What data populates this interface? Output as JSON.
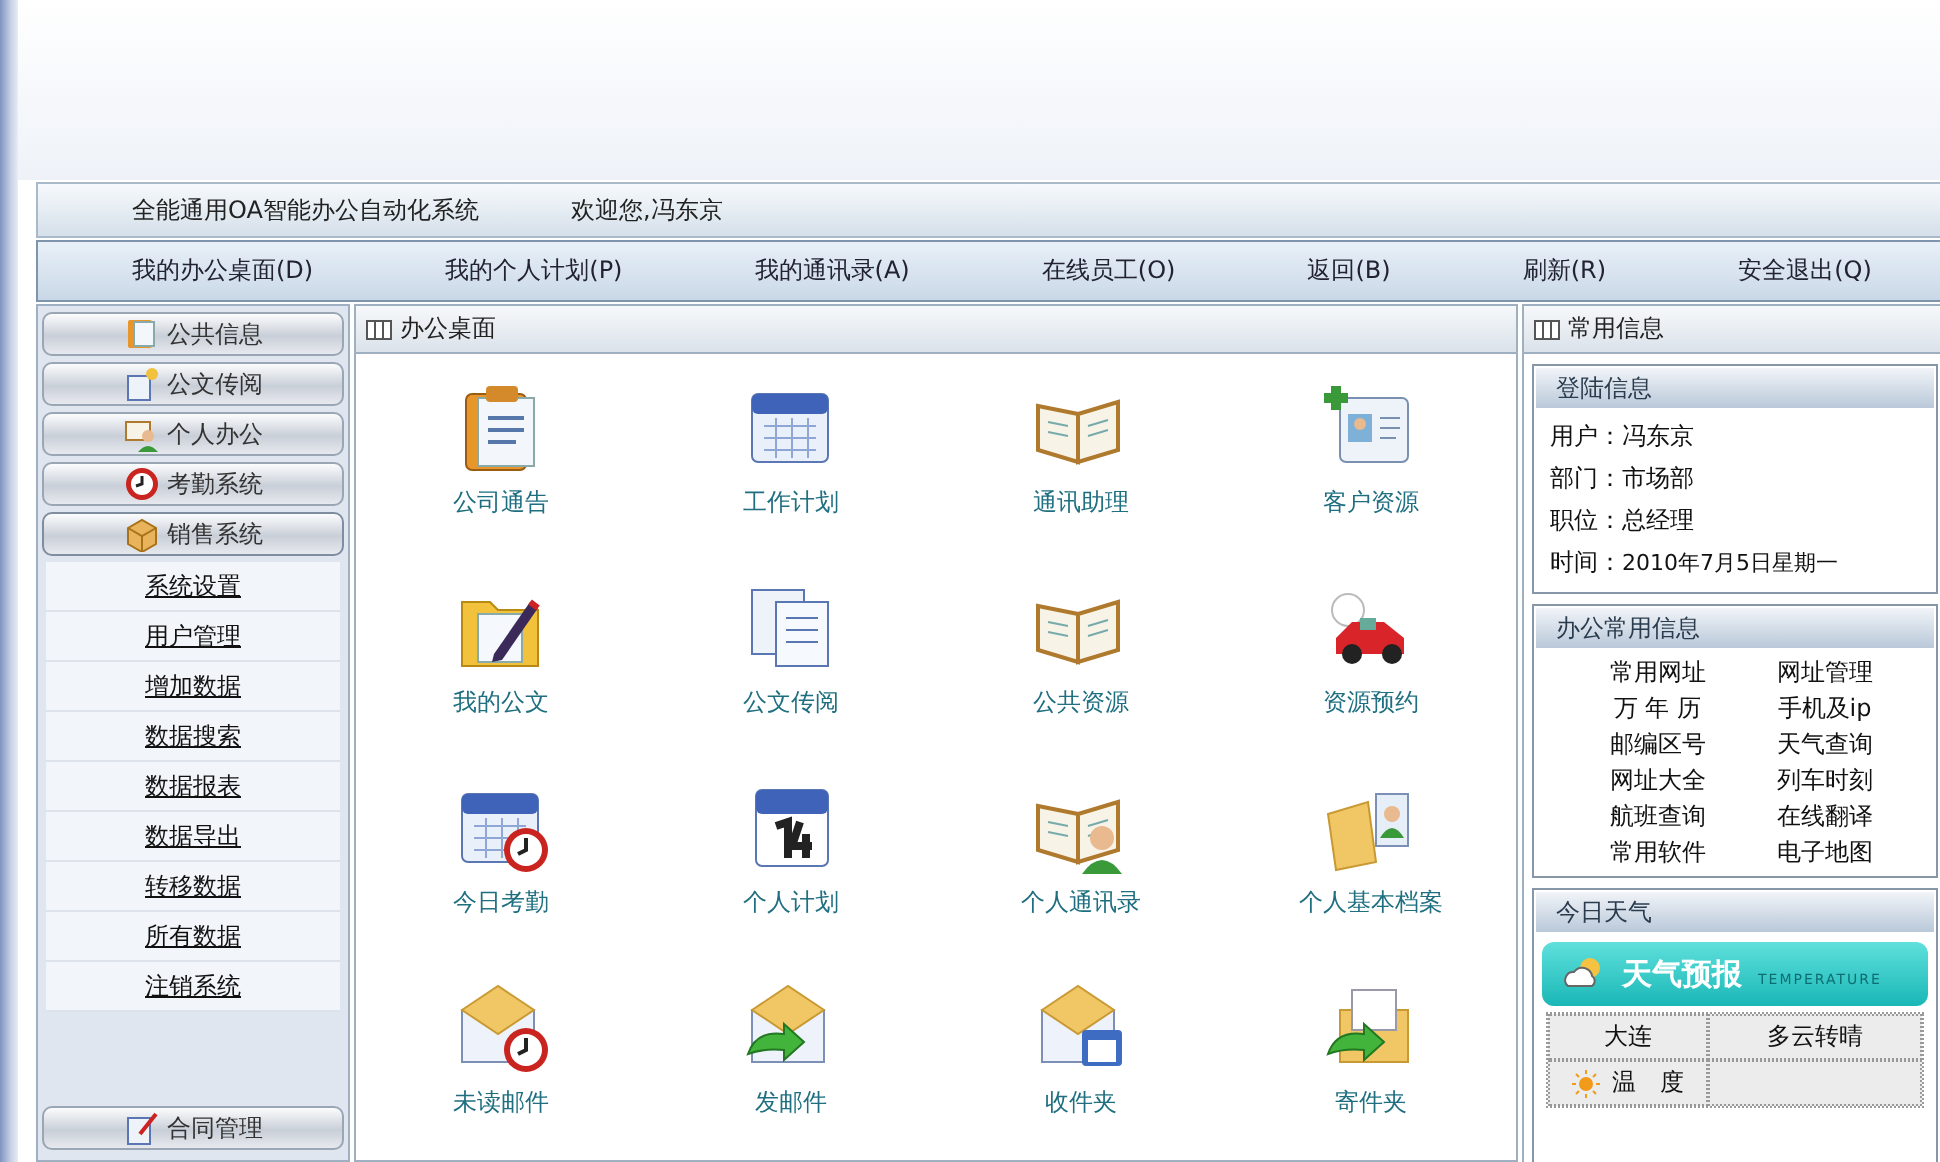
{
  "header": {
    "title": "全能通用OA智能办公自动化系统",
    "welcome": "欢迎您,冯东京"
  },
  "nav": [
    {
      "label": "我的办公桌面(D)"
    },
    {
      "label": "我的个人计划(P)"
    },
    {
      "label": "我的通讯录(A)"
    },
    {
      "label": "在线员工(O)"
    },
    {
      "label": "返回(B)"
    },
    {
      "label": "刷新(R)"
    },
    {
      "label": "安全退出(Q)"
    }
  ],
  "sidebar": {
    "groups": [
      {
        "label": "公共信息",
        "expanded": false
      },
      {
        "label": "公文传阅",
        "expanded": false
      },
      {
        "label": "个人办公",
        "expanded": false
      },
      {
        "label": "考勤系统",
        "expanded": false
      },
      {
        "label": "销售系统",
        "expanded": true,
        "children": [
          "系统设置",
          "用户管理",
          "增加数据",
          "数据搜索",
          "数据报表",
          "数据导出",
          "转移数据",
          "所有数据",
          "注销系统"
        ]
      },
      {
        "label": "合同管理",
        "expanded": false
      }
    ]
  },
  "desktop": {
    "title": "办公桌面",
    "shortcuts": [
      {
        "label": "公司通告"
      },
      {
        "label": "工作计划"
      },
      {
        "label": "通讯助理"
      },
      {
        "label": "客户资源"
      },
      {
        "label": "我的公文"
      },
      {
        "label": "公文传阅"
      },
      {
        "label": "公共资源"
      },
      {
        "label": "资源预约"
      },
      {
        "label": "今日考勤"
      },
      {
        "label": "个人计划"
      },
      {
        "label": "个人通讯录"
      },
      {
        "label": "个人基本档案"
      },
      {
        "label": "未读邮件"
      },
      {
        "label": "发邮件"
      },
      {
        "label": "收件夹"
      },
      {
        "label": "寄件夹"
      }
    ]
  },
  "info": {
    "title": "常用信息",
    "login": {
      "title": "登陆信息",
      "fields": [
        {
          "label": "用户：",
          "value": "冯东京"
        },
        {
          "label": "部门：",
          "value": "市场部"
        },
        {
          "label": "职位：",
          "value": "总经理"
        },
        {
          "label": "时间：",
          "value": "2010年7月5日星期一"
        }
      ]
    },
    "office": {
      "title": "办公常用信息",
      "links": [
        "常用网址",
        "网址管理",
        "万 年 历",
        "手机及ip",
        "邮编区号",
        "天气查询",
        "网址大全",
        "列车时刻",
        "航班查询",
        "在线翻译",
        "常用软件",
        "电子地图"
      ]
    },
    "weather": {
      "title": "今日天气",
      "banner": "天气预报",
      "banner_sub": "TEMPERATURE",
      "rows": [
        {
          "label": "大连",
          "value": "多云转晴"
        },
        {
          "label": "温　度"
        }
      ]
    }
  }
}
